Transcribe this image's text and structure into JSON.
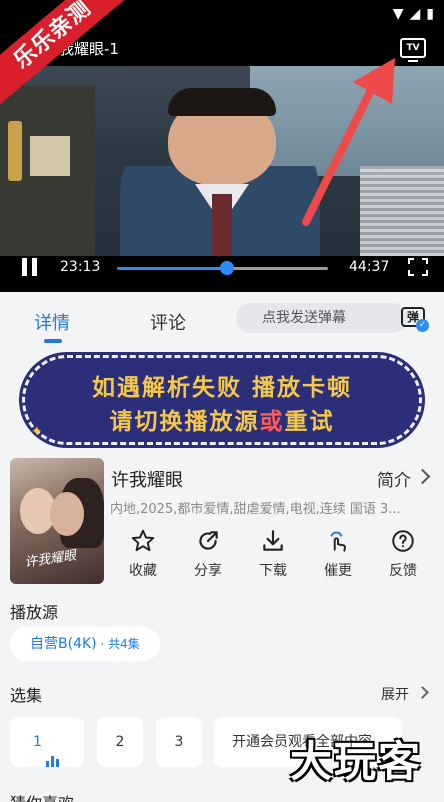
{
  "promo_ribbon": "乐乐亲测",
  "player": {
    "title": "许我耀眼-1",
    "tv_label": "TV",
    "current_time": "23:13",
    "total_time": "44:37",
    "progress": 0.52
  },
  "tabs": {
    "detail": "详情",
    "comment": "评论"
  },
  "danmu": {
    "placeholder": "点我发送弹幕",
    "icon_char": "弹",
    "check": "✓"
  },
  "banner": {
    "line1": "如遇解析失败 播放卡顿",
    "line2a": "请切换播放源",
    "line2b": "或",
    "line2c": "重试"
  },
  "show": {
    "poster_title": "许我耀眼",
    "title": "许我耀眼",
    "intro_label": "简介",
    "meta": "内地,2025,都市爱情,甜虐爱情,电视,连续 国语 3..."
  },
  "actions": [
    {
      "label": "收藏",
      "icon": "star-icon"
    },
    {
      "label": "分享",
      "icon": "share-icon"
    },
    {
      "label": "下载",
      "icon": "download-icon"
    },
    {
      "label": "催更",
      "icon": "urge-icon"
    },
    {
      "label": "反馈",
      "icon": "feedback-icon"
    }
  ],
  "source": {
    "section_title": "播放源",
    "name": "自营B(4K)",
    "count": " · 共4集"
  },
  "episodes": {
    "section_title": "选集",
    "expand_label": "展开",
    "items": [
      "1",
      "2",
      "3"
    ],
    "vip_text": "开通会员观看全部内容"
  },
  "watermark": "大玩客",
  "guess_title": "猜你喜欢",
  "colors": {
    "accent": "#2378e0",
    "banner_bg": "#2b2e78",
    "banner_text": "#f6c84a",
    "ribbon": "#d81f2b"
  }
}
